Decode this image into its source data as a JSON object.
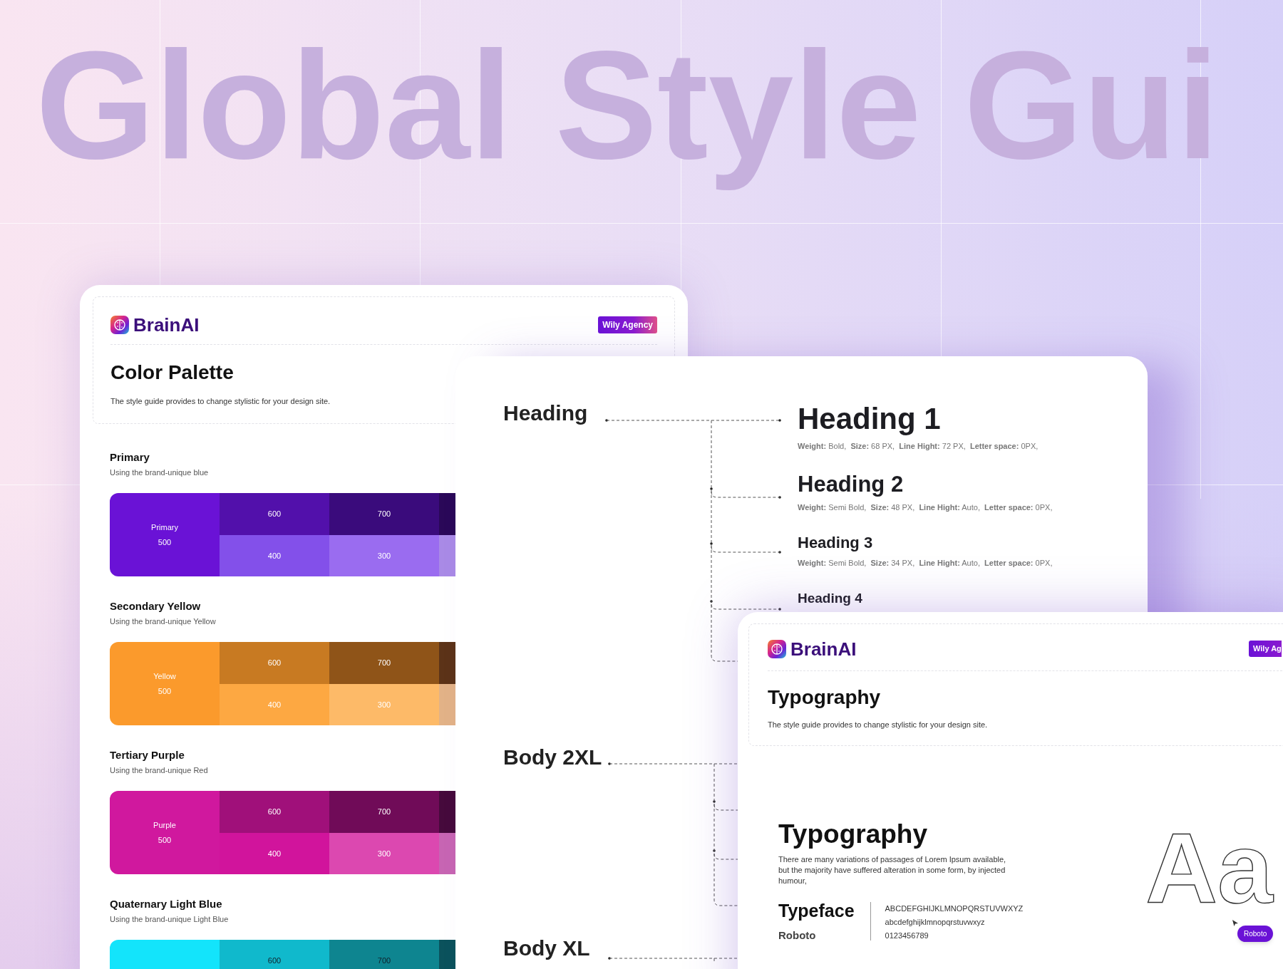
{
  "hero_title": "Global Style Gui",
  "palette_card": {
    "brand": "BrainAI",
    "badge": "Wily Agency",
    "title": "Color Palette",
    "description": "The style guide provides to change stylistic for your design site.",
    "palettes": [
      {
        "name": "Primary",
        "subtitle": "Using the brand-unique blue",
        "dark_labels": false,
        "base": {
          "lines": [
            "Primary",
            "500"
          ],
          "color": "#6a12d6"
        },
        "top": [
          {
            "label": "600",
            "color": "#5210ab"
          },
          {
            "label": "700",
            "color": "#3a0b7c"
          },
          {
            "color": "#2a0858"
          }
        ],
        "bottom": [
          {
            "label": "400",
            "color": "#8350ea"
          },
          {
            "label": "300",
            "color": "#9a6cf0"
          },
          {
            "color": "#a98ae6"
          }
        ]
      },
      {
        "name": "Secondary Yellow",
        "subtitle": "Using the brand-unique Yellow",
        "dark_labels": false,
        "base": {
          "lines": [
            "Yellow",
            "500"
          ],
          "color": "#fb9a2c"
        },
        "top": [
          {
            "label": "600",
            "color": "#c87a22"
          },
          {
            "label": "700",
            "color": "#8f5418"
          },
          {
            "color": "#5c3318"
          }
        ],
        "bottom": [
          {
            "label": "400",
            "color": "#fda842"
          },
          {
            "label": "300",
            "color": "#fdba68"
          },
          {
            "color": "#e2b287"
          }
        ]
      },
      {
        "name": "Tertiary Purple",
        "subtitle": "Using the brand-unique Red",
        "dark_labels": false,
        "base": {
          "lines": [
            "Purple",
            "500"
          ],
          "color": "#d0189e"
        },
        "top": [
          {
            "label": "600",
            "color": "#a0107a"
          },
          {
            "label": "700",
            "color": "#700b58"
          },
          {
            "color": "#460a3c"
          }
        ],
        "bottom": [
          {
            "label": "400",
            "color": "#d1149c"
          },
          {
            "label": "300",
            "color": "#dc48b0"
          },
          {
            "color": "#c765b3"
          }
        ]
      },
      {
        "name": "Quaternary Light Blue",
        "subtitle": "Using the brand-unique Light Blue",
        "dark_labels": true,
        "base": {
          "color": "#13e4fb"
        },
        "top": [
          {
            "label": "600",
            "color": "#10b9cc"
          },
          {
            "label": "700",
            "color": "#0e8590"
          },
          {
            "color": "#0b525c"
          }
        ]
      }
    ]
  },
  "hierarchy_card": {
    "groups": [
      {
        "label": "Heading"
      },
      {
        "label": "Body 2XL"
      },
      {
        "label": "Body XL"
      }
    ],
    "headings": [
      {
        "kind": "h1",
        "title": "Heading 1",
        "spec": "**Weight:** Bold,  **Size:** 68 PX,  **Line Hight:** 72 PX,  **Letter space:** 0PX,"
      },
      {
        "kind": "h2",
        "title": "Heading 2",
        "spec": "**Weight:** Semi Bold,  **Size:** 48 PX,  **Line Hight:** Auto,  **Letter space:** 0PX,"
      },
      {
        "kind": "h3",
        "title": "Heading 3",
        "spec": "**Weight:** Semi Bold,  **Size:** 34 PX,  **Line Hight:** Auto,  **Letter space:** 0PX,"
      },
      {
        "kind": "h4",
        "title": "Heading 4"
      }
    ]
  },
  "typography_card": {
    "brand": "BrainAI",
    "badge": "Wily Ag",
    "title": "Typography",
    "description": "The style guide provides to change stylistic for your design site.",
    "sample": {
      "title": "Typography",
      "text": "There are many variations of passages of Lorem Ipsum available, but the majority have suffered alteration in some form, by injected humour,",
      "typeface_label": "Typeface",
      "font_name": "Roboto",
      "glyph_rows": [
        "ABCDEFGHIJKLMNOPQRSTUVWXYZ",
        "abcdefghijklmnopqrstuvwxyz",
        "0123456789"
      ],
      "specimen": "Aa",
      "tag": "Roboto"
    }
  }
}
